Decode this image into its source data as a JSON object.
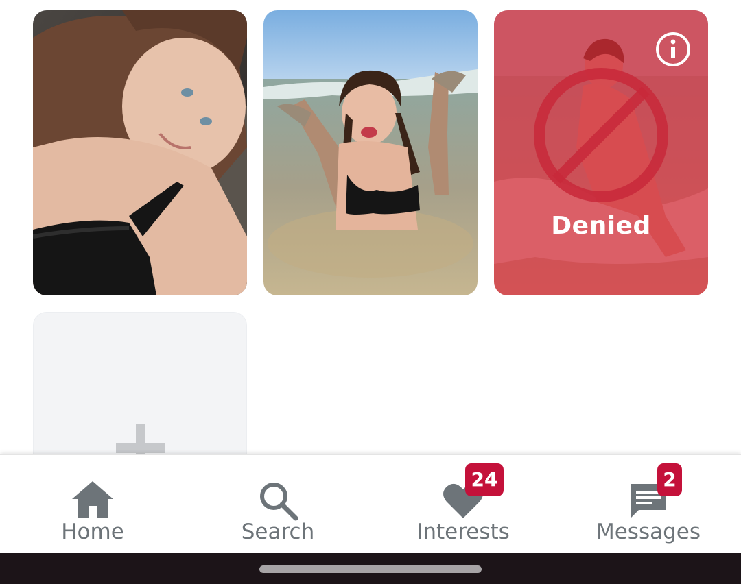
{
  "photos": [
    {
      "name": "profile-photo-1",
      "status": ""
    },
    {
      "name": "profile-photo-2",
      "status": ""
    },
    {
      "name": "profile-photo-3",
      "status": "Denied",
      "overlay_color": "#d62834"
    }
  ],
  "add_photo": {
    "icon": "plus-icon"
  },
  "nav": {
    "home_label": "Home",
    "search_label": "Search",
    "interests_label": "Interests",
    "interests_badge": "24",
    "messages_label": "Messages",
    "messages_badge": "2",
    "icon_color": "#6d7479",
    "badge_color": "#c4113a"
  }
}
